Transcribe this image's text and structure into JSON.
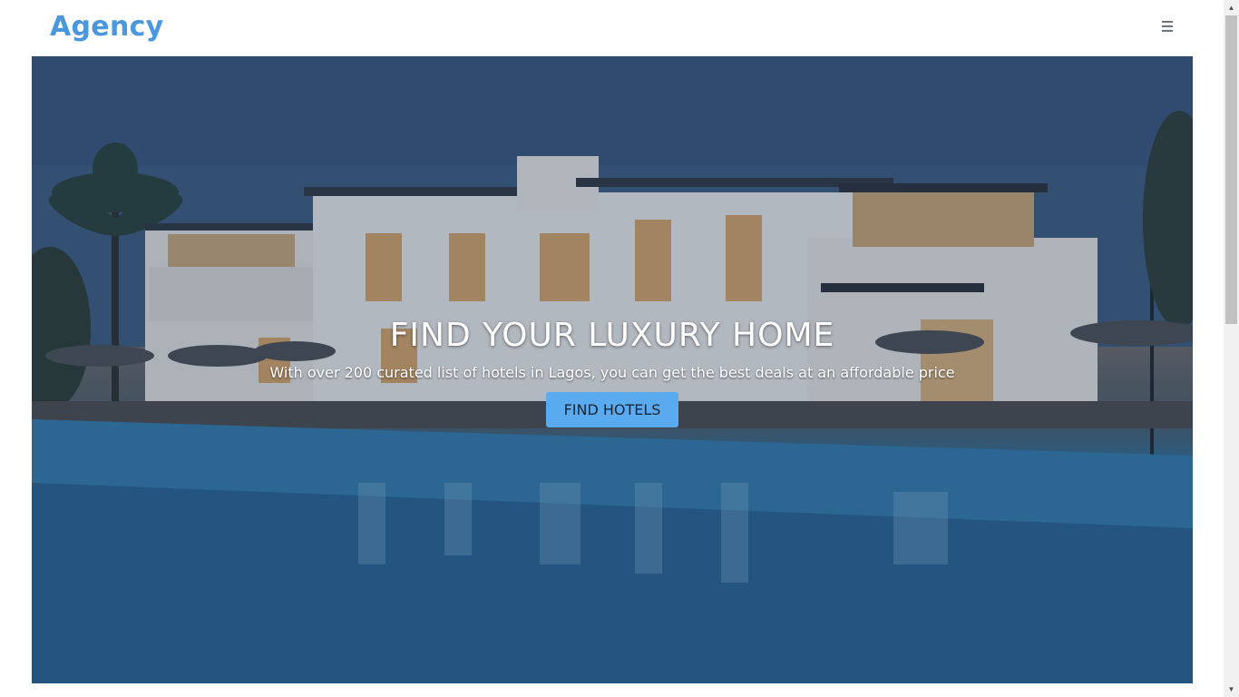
{
  "header": {
    "logo": "Agency",
    "menu_icon": "hamburger-menu-icon"
  },
  "hero": {
    "title": "FIND YOUR LUXURY HOME",
    "subtitle": "With over 200 curated list of hotels in Lagos, you can get the best deals at an affordable price",
    "button_label": "FIND HOTELS",
    "background_image": "luxury hotel with pool at dusk"
  },
  "colors": {
    "brand": "#4a97dd",
    "button": "#5aaaf0",
    "overlay": "#1e3250"
  },
  "scrollbar": {
    "up_icon": "scroll-up-arrow-icon",
    "down_icon": "scroll-down-arrow-icon"
  }
}
